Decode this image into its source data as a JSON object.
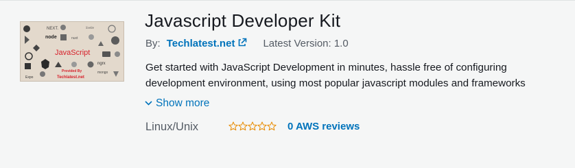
{
  "product": {
    "title": "Javascript Developer Kit",
    "by_label": "By:",
    "vendor": "Techlatest.net",
    "version_label": "Latest Version:",
    "version_value": "1.0",
    "description": "Get started with JavaScript Development in minutes, hassle free of configuring development environment, using most popular javascript modules and frameworks",
    "show_more": "Show more",
    "platform": "Linux/Unix",
    "rating": 0,
    "rating_max": 5,
    "reviews": "0 AWS reviews"
  },
  "thumbnail": {
    "headline": "JavaScript",
    "footer_line1": "Provided By",
    "footer_line2": "Techlatest.net",
    "logo_words": [
      "NEXT.",
      "node",
      "Expo",
      "mongo",
      "ngrx"
    ]
  },
  "colors": {
    "link": "#0073bb",
    "star_outline": "#e88b01",
    "title": "#16191f",
    "muted": "#545b64"
  },
  "icons": {
    "external_link": "external-link-icon",
    "chevron": "chevron-down-icon",
    "star": "star-outline-icon"
  }
}
